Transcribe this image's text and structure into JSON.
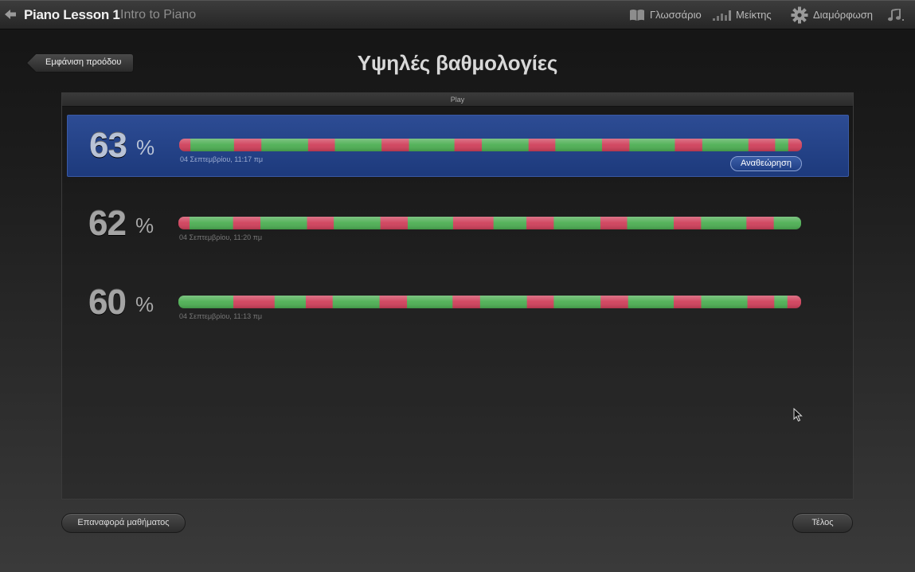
{
  "topbar": {
    "title": "Piano Lesson 1",
    "subtitle": "Intro to Piano",
    "glossary_label": "Γλωσσάριο",
    "mixer_label": "Μείκτης",
    "settings_label": "Διαμόρφωση",
    "icons": [
      "back-arrow-icon",
      "book-icon",
      "mixer-icon",
      "gear-icon",
      "music-note-icon"
    ]
  },
  "header": {
    "progress_button": "Εμφάνιση προόδου",
    "title": "Υψηλές βαθμολογίες"
  },
  "panel": {
    "tab_label": "Play",
    "review_button": "Αναθεώρηση",
    "scores": [
      {
        "percent": "63",
        "sign": "%",
        "date": "04 Σεπτεμβρίου, 11:17 πμ",
        "selected": true,
        "segments": [
          "r",
          1.8,
          "g",
          7,
          "r",
          4.4,
          "g",
          7.5,
          "r",
          4.3,
          "g",
          7.5,
          "r",
          4.4,
          "g",
          7.3,
          "r",
          4.4,
          "g",
          7.5,
          "r",
          4.3,
          "g",
          7.5,
          "r",
          4.4,
          "g",
          7.3,
          "r",
          4.4,
          "g",
          7.4,
          "r",
          4.3,
          "g",
          2.1,
          "r",
          2.2
        ]
      },
      {
        "percent": "62",
        "sign": "%",
        "date": "04 Σεπτεμβρίου, 11:20 πμ",
        "selected": false,
        "segments": [
          "r",
          1.8,
          "g",
          7,
          "r",
          4.4,
          "g",
          7.5,
          "r",
          4.3,
          "g",
          7.5,
          "r",
          4.4,
          "g",
          7.3,
          "r",
          6.5,
          "g",
          5.3,
          "r",
          4.4,
          "g",
          7.5,
          "r",
          4.3,
          "g",
          7.5,
          "r",
          4.4,
          "g",
          7.3,
          "r",
          4.4,
          "g",
          4.4
        ]
      },
      {
        "percent": "60",
        "sign": "%",
        "date": "04 Σεπτεμβρίου, 11:13 πμ",
        "selected": false,
        "segments": [
          "g",
          8.8,
          "r",
          6.6,
          "g",
          5,
          "r",
          4.3,
          "g",
          7.5,
          "r",
          4.4,
          "g",
          7.3,
          "r",
          4.4,
          "g",
          7.5,
          "r",
          4.3,
          "g",
          7.5,
          "r",
          4.4,
          "g",
          7.3,
          "r",
          4.4,
          "g",
          7.4,
          "r",
          4.3,
          "g",
          2.1,
          "r",
          2.2
        ]
      }
    ]
  },
  "footer": {
    "reset_button": "Επαναφορά μαθήματος",
    "done_button": "Τέλος"
  },
  "colors": {
    "green": "#4cae52",
    "red": "#cf3f5a",
    "selected_row": "#24438a"
  }
}
